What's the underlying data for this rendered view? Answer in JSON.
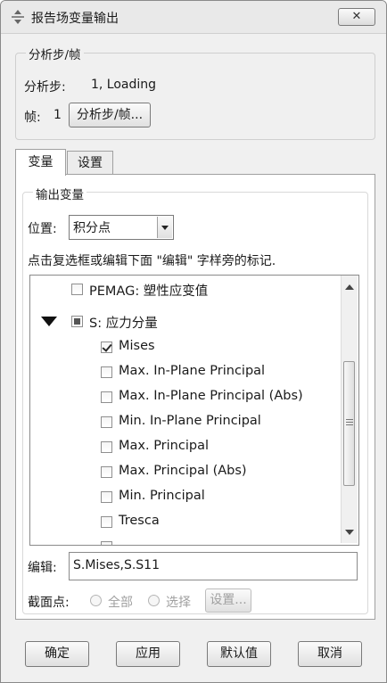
{
  "window": {
    "title": "报告场变量输出",
    "close_glyph": "✕"
  },
  "step_frame": {
    "legend": "分析步/帧",
    "step_label": "分析步:",
    "step_value": "1, Loading",
    "frame_label": "帧:",
    "frame_value": "1",
    "button": "分析步/帧..."
  },
  "tabs": [
    {
      "label": "变量",
      "active": true
    },
    {
      "label": "设置",
      "active": false
    }
  ],
  "output_vars": {
    "legend": "输出变量",
    "position_label": "位置:",
    "position_value": "积分点",
    "instruction": "点击复选框或编辑下面 \"编辑\" 字样旁的标记.",
    "items": [
      {
        "label": "PEMAG: 塑性应变值",
        "state": "unchecked"
      },
      {
        "label": "S: 应力分量",
        "state": "partial",
        "expanded": true
      },
      {
        "label": "Mises",
        "state": "checked"
      },
      {
        "label": "Max. In-Plane Principal",
        "state": "unchecked"
      },
      {
        "label": "Max. In-Plane Principal (Abs)",
        "state": "unchecked"
      },
      {
        "label": "Min. In-Plane Principal",
        "state": "unchecked"
      },
      {
        "label": "Max. Principal",
        "state": "unchecked"
      },
      {
        "label": "Max. Principal (Abs)",
        "state": "unchecked"
      },
      {
        "label": "Min. Principal",
        "state": "unchecked"
      },
      {
        "label": "Tresca",
        "state": "unchecked"
      }
    ],
    "edit_label": "编辑:",
    "edit_value": "S.Mises,S.S11",
    "section_label": "截面点:",
    "section_all": "全部",
    "section_select": "选择",
    "section_settings": "设置..."
  },
  "footer": {
    "ok": "确定",
    "apply": "应用",
    "defaults": "默认值",
    "cancel": "取消"
  }
}
